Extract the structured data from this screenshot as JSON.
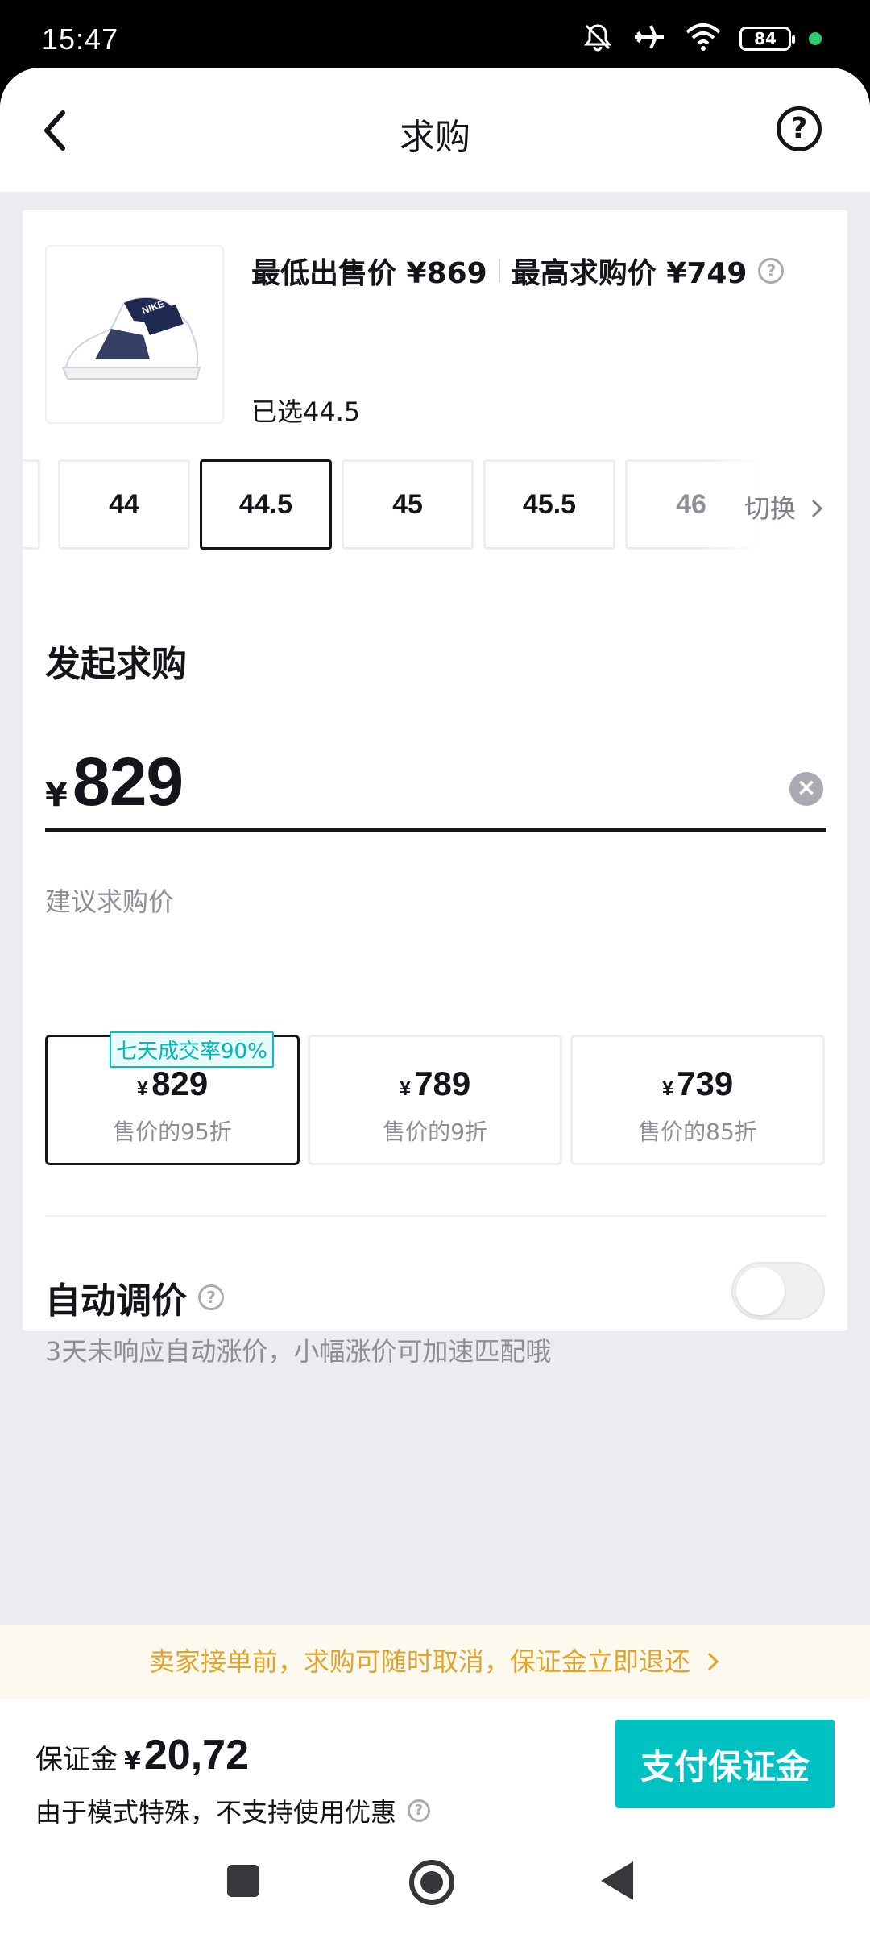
{
  "status_bar": {
    "time": "15:47",
    "battery": "84",
    "icons": [
      "mute-bell-icon",
      "airplane-icon",
      "wifi-icon",
      "battery-icon",
      "green-dot"
    ]
  },
  "nav": {
    "title": "求购",
    "back_icon": "chevron-left-icon",
    "help_icon": "question-circle-icon"
  },
  "product": {
    "lowest_ask_label": "最低出售价 ¥869",
    "highest_bid_label": "最高求购价 ¥749",
    "selected_size_text": "已选44.5",
    "sizes": [
      "44",
      "44.5",
      "45",
      "45.5",
      "46"
    ],
    "selected_size": "44.5",
    "switch_label": "切换"
  },
  "bid": {
    "section_title": "发起求购",
    "currency_symbol": "¥",
    "price_value": "829",
    "suggest_label": "建议求购价",
    "suggestions": [
      {
        "price": "829",
        "sub": "售价的95折",
        "badge": "七天成交率90%"
      },
      {
        "price": "789",
        "sub": "售价的9折"
      },
      {
        "price": "739",
        "sub": "售价的85折"
      }
    ],
    "auto_adjust_title": "自动调价",
    "auto_adjust_desc": "3天未响应自动涨价，小幅涨价可加速匹配哦",
    "auto_adjust_on": false
  },
  "notice": {
    "text": "卖家接单前，求购可随时取消，保证金立即退还"
  },
  "footer": {
    "deposit_label": "保证金",
    "deposit_currency": "¥",
    "deposit_value": "20,72",
    "deposit_note": "由于模式特殊，不支持使用优惠",
    "pay_button": "支付保证金"
  },
  "colors": {
    "accent": "#01c2c3",
    "notice_text": "#e0a42b",
    "notice_bg": "#fef9ef",
    "page_bg": "#ebebf0"
  }
}
